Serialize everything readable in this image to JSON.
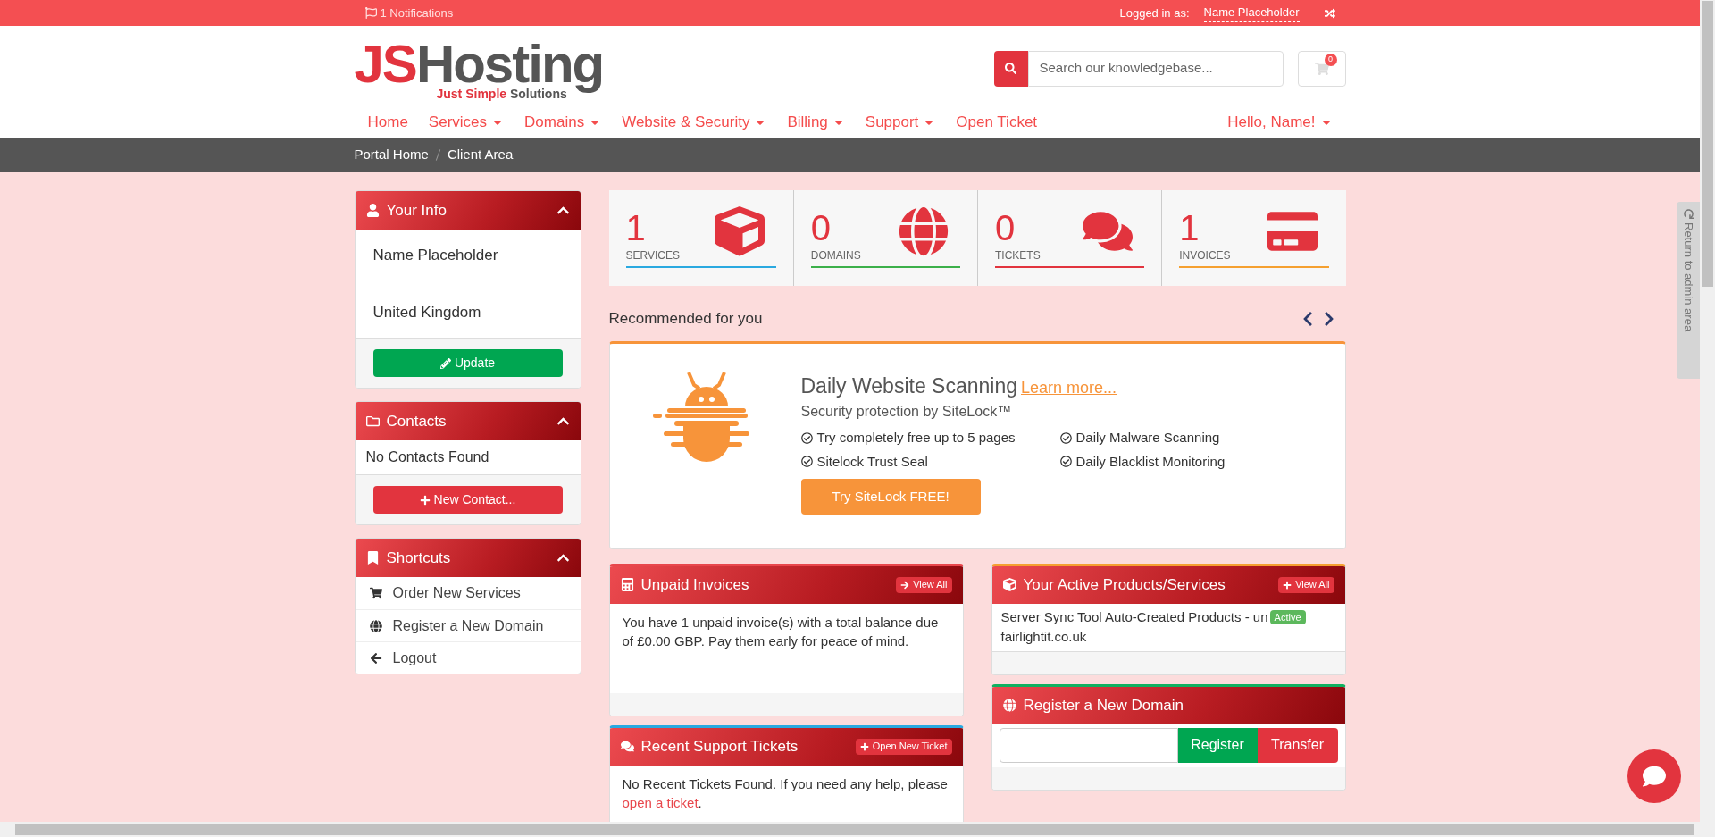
{
  "top_bar": {
    "notifications": "1 Notifications",
    "logged_in_label": "Logged in as:",
    "user": "Name Placeholder"
  },
  "logo": {
    "part1": "JS",
    "part2": "Hosting",
    "tagline_bold": "Just Simple",
    "tagline_rest": "Solutions"
  },
  "search": {
    "placeholder": "Search our knowledgebase..."
  },
  "cart": {
    "count": "0"
  },
  "nav": {
    "items": [
      {
        "label": "Home",
        "dropdown": false
      },
      {
        "label": "Services",
        "dropdown": true
      },
      {
        "label": "Domains",
        "dropdown": true
      },
      {
        "label": "Website & Security",
        "dropdown": true
      },
      {
        "label": "Billing",
        "dropdown": true
      },
      {
        "label": "Support",
        "dropdown": true
      },
      {
        "label": "Open Ticket",
        "dropdown": false
      }
    ],
    "account": {
      "label": "Hello, Name!",
      "dropdown": true
    }
  },
  "breadcrumb": [
    "Portal Home",
    "Client Area"
  ],
  "sidebar": [
    {
      "kind": "info",
      "title": "Your Info",
      "expanded": true,
      "lines": [
        "Name Placeholder",
        "United Kingdom"
      ],
      "button": "Update"
    },
    {
      "kind": "contacts",
      "title": "Contacts",
      "expanded": true,
      "message": "No Contacts Found",
      "button": "New Contact..."
    },
    {
      "kind": "links",
      "title": "Shortcuts",
      "expanded": true,
      "items": [
        "Order New Services",
        "Register a New Domain",
        "Logout"
      ]
    }
  ],
  "stats": [
    {
      "value": "1",
      "label": "SERVICES",
      "color": "#2aa9e0"
    },
    {
      "value": "0",
      "label": "DOMAINS",
      "color": "#3cb04a"
    },
    {
      "value": "0",
      "label": "TICKETS",
      "color": "#e2343e"
    },
    {
      "value": "1",
      "label": "INVOICES",
      "color": "#f5a030"
    }
  ],
  "recommended": {
    "title": "Recommended for you",
    "promo": {
      "heading": "Daily Website Scanning",
      "link": "Learn more...",
      "subheading": "Security protection by SiteLock™",
      "features": [
        "Try completely free up to 5 pages",
        "Daily Malware Scanning",
        "Sitelock Trust Seal",
        "Daily Blacklist Monitoring"
      ],
      "button": "Try SiteLock FREE!"
    }
  },
  "left_panels": [
    {
      "kind": "text",
      "title": "Unpaid Invoices",
      "color": "#e8474c",
      "action": "View All",
      "text": "You have 1 unpaid invoice(s) with a total balance due of £0.00 GBP. Pay them early for peace of mind."
    },
    {
      "kind": "tickets",
      "title": "Recent Support Tickets",
      "color": "#2aa9e0",
      "action": "Open New Ticket",
      "text": "No Recent Tickets Found. If you need any help, please ",
      "link": "open a ticket",
      "after": "."
    }
  ],
  "right_panels": [
    {
      "kind": "products",
      "title": "Your Active Products/Services",
      "color": "#f5a030",
      "action": "View All",
      "product": "Server Sync Tool Auto-Created Products - un",
      "status": "Active",
      "domain": "fairlightit.co.uk"
    },
    {
      "kind": "domain",
      "title": "Register a New Domain",
      "color": "#10b060",
      "buttons": [
        "Register",
        "Transfer"
      ]
    }
  ],
  "admin_tab": {
    "label": "Return to admin area"
  }
}
